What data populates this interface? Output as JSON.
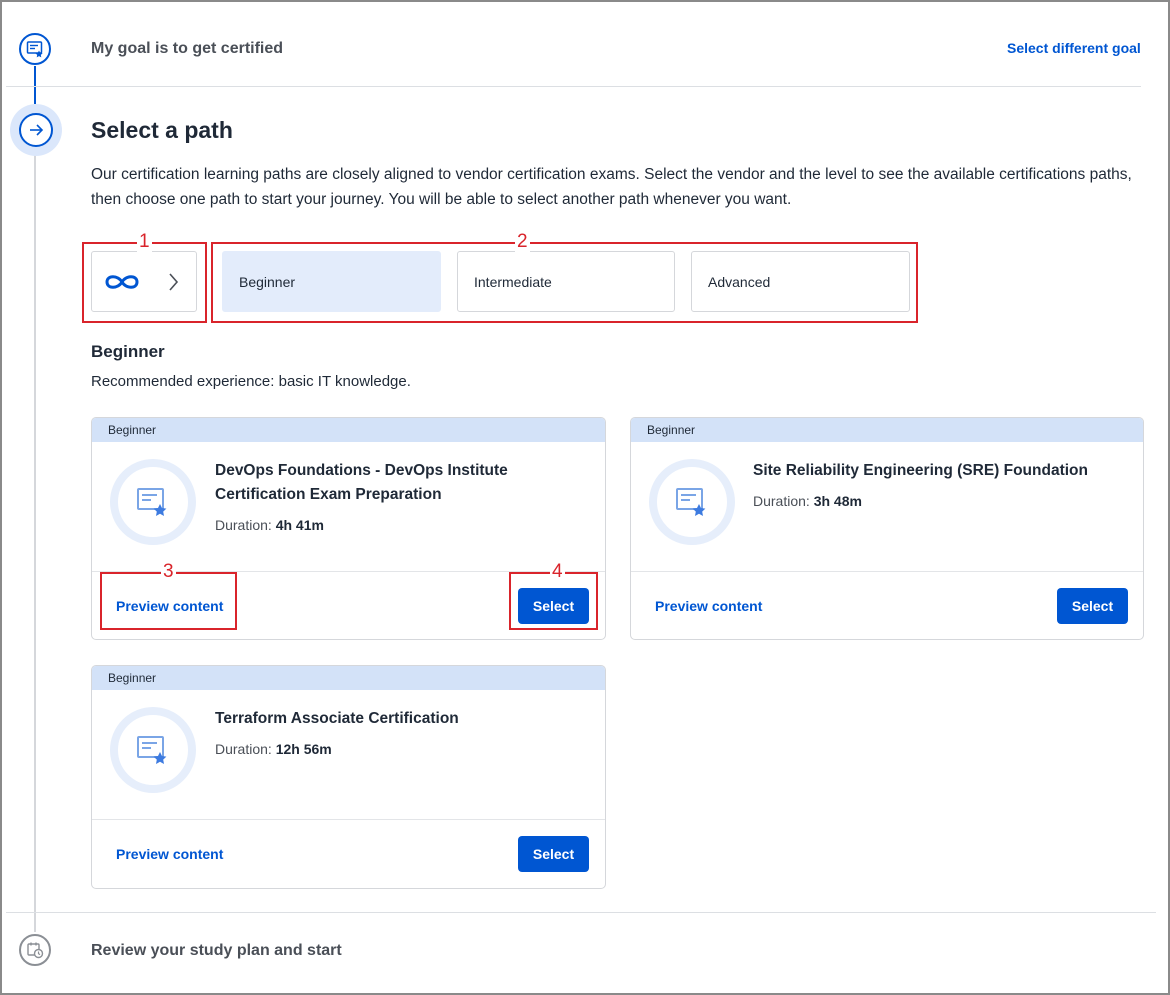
{
  "goal_step": {
    "title": "My goal is to get certified",
    "change_link": "Select different goal"
  },
  "path_step": {
    "title": "Select a path",
    "description_line1": "Our certification learning paths are closely aligned to vendor certification exams. Select the vendor and the level to see the available certifications paths,",
    "description_line2": "then choose one path to start your journey. You will be able to select another path whenever you want."
  },
  "vendor_selector": {
    "icon": "infinity-icon",
    "chevron": "chevron-right-icon"
  },
  "levels": [
    {
      "label": "Beginner",
      "selected": true
    },
    {
      "label": "Intermediate",
      "selected": false
    },
    {
      "label": "Advanced",
      "selected": false
    }
  ],
  "level_section": {
    "heading": "Beginner",
    "experience": "Recommended experience: basic IT knowledge."
  },
  "cards": [
    {
      "badge": "Beginner",
      "title_line1": "DevOps Foundations - DevOps Institute",
      "title_line2": "Certification Exam Preparation",
      "duration_label": "Duration:",
      "duration": "4h 41m",
      "preview": "Preview content",
      "select": "Select"
    },
    {
      "badge": "Beginner",
      "title_line1": "Site Reliability Engineering (SRE) Foundation",
      "title_line2": "",
      "duration_label": "Duration:",
      "duration": "3h 48m",
      "preview": "Preview content",
      "select": "Select"
    },
    {
      "badge": "Beginner",
      "title_line1": "Terraform Associate Certification",
      "title_line2": "",
      "duration_label": "Duration:",
      "duration": "12h 56m",
      "preview": "Preview content",
      "select": "Select"
    }
  ],
  "annotations": [
    "1",
    "2",
    "3",
    "4"
  ],
  "review_step": {
    "title": "Review your study plan and start"
  },
  "colors": {
    "accent": "#0056d2",
    "annotation": "#d9242b",
    "card_header": "#d3e2f8",
    "selected_level": "#e3ecfb"
  }
}
